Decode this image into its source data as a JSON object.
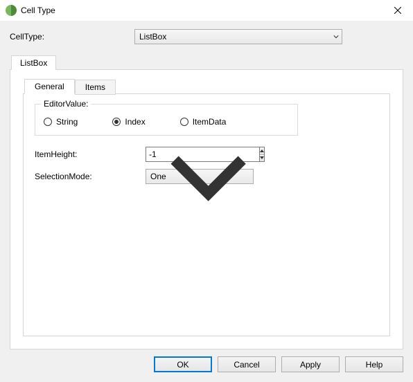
{
  "window": {
    "title": "Cell Type"
  },
  "celltype": {
    "label": "CellType:",
    "value": "ListBox"
  },
  "outer_tabs": {
    "listbox": "ListBox"
  },
  "inner_tabs": {
    "general": "General",
    "items": "Items"
  },
  "editor_value": {
    "group_label": "EditorValue:",
    "options": {
      "string": "String",
      "index": "Index",
      "itemdata": "ItemData"
    },
    "selected": "index"
  },
  "item_height": {
    "label": "ItemHeight:",
    "value": "-1"
  },
  "selection_mode": {
    "label": "SelectionMode:",
    "value": "One"
  },
  "buttons": {
    "ok": "OK",
    "cancel": "Cancel",
    "apply": "Apply",
    "help": "Help"
  }
}
